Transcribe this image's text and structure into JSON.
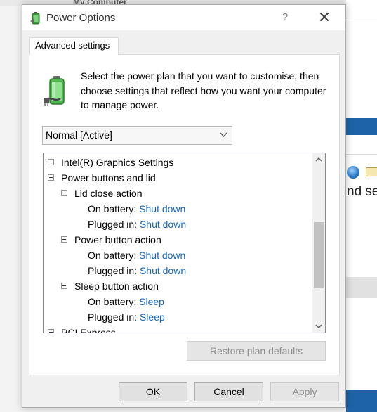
{
  "background": {
    "window_title": "My Computer",
    "partial_text": "nd se"
  },
  "dialog": {
    "title": "Power Options",
    "help_glyph": "?",
    "close_glyph": "✕"
  },
  "tab": {
    "label": "Advanced settings"
  },
  "intro_text": "Select the power plan that you want to customise, then choose settings that reflect how you want your computer to manage power.",
  "plan_select": {
    "value": "Normal [Active]"
  },
  "tree": {
    "items": [
      {
        "label": "Intel(R) Graphics Settings",
        "state": "collapsed"
      },
      {
        "label": "Power buttons and lid",
        "state": "expanded"
      },
      {
        "label": "Lid close action",
        "state": "expanded"
      },
      {
        "label": "On battery:",
        "value": "Shut down"
      },
      {
        "label": "Plugged in:",
        "value": "Shut down"
      },
      {
        "label": "Power button action",
        "state": "expanded"
      },
      {
        "label": "On battery:",
        "value": "Shut down"
      },
      {
        "label": "Plugged in:",
        "value": "Shut down"
      },
      {
        "label": "Sleep button action",
        "state": "expanded"
      },
      {
        "label": "On battery:",
        "value": "Sleep"
      },
      {
        "label": "Plugged in:",
        "value": "Sleep"
      },
      {
        "label": "PCI Express",
        "state": "collapsed"
      }
    ]
  },
  "buttons": {
    "restore": "Restore plan defaults",
    "ok": "OK",
    "cancel": "Cancel",
    "apply": "Apply"
  },
  "colors": {
    "value_link": "#1565c0",
    "taskbar_blue": "#1e63a8"
  },
  "icons": {
    "title": "power-options-icon",
    "plan": "battery-plug-icon"
  }
}
